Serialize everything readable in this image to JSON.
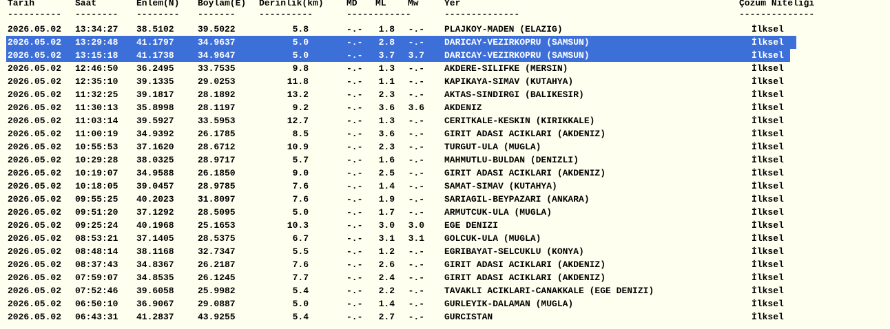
{
  "columns": {
    "date": "Tarih",
    "time": "Saat",
    "lat": "Enlem(N)",
    "lon": "Boylam(E)",
    "depth": "Derinlik(km)",
    "md": "MD",
    "ml": "ML",
    "mw": "Mw",
    "place": "Yer",
    "quality": "Çözüm Niteliği"
  },
  "separators": {
    "date": "----------",
    "time": "--------",
    "lat": "--------",
    "lon": "-------",
    "depth": "----------",
    "mag": "------------",
    "place": "--------------",
    "quality": "--------------"
  },
  "rows": [
    {
      "date": "2026.05.02",
      "time": "13:34:27",
      "lat": "38.5102",
      "lon": "39.5022",
      "depth": "5.8",
      "md": "-.-",
      "ml": "1.8",
      "mw": "-.-",
      "place": "PLAJKOY-MADEN (ELAZIG)",
      "quality": "İlksel",
      "selected": false
    },
    {
      "date": "2026.05.02",
      "time": "13:29:48",
      "lat": "41.1797",
      "lon": "34.9637",
      "depth": "5.0",
      "md": "-.-",
      "ml": "2.8",
      "mw": "-.-",
      "place": "DARICAY-VEZIRKOPRU (SAMSUN)",
      "quality": "İlksel",
      "selected": true
    },
    {
      "date": "2026.05.02",
      "time": "13:15:18",
      "lat": "41.1738",
      "lon": "34.9647",
      "depth": "5.0",
      "md": "-.-",
      "ml": "3.7",
      "mw": "3.7",
      "place": "DARICAY-VEZIRKOPRU (SAMSUN)",
      "quality": "İlksel",
      "selected": true
    },
    {
      "date": "2026.05.02",
      "time": "12:46:50",
      "lat": "36.2495",
      "lon": "33.7535",
      "depth": "9.8",
      "md": "-.-",
      "ml": "1.3",
      "mw": "-.-",
      "place": "AKDERE-SILIFKE (MERSIN)",
      "quality": "İlksel",
      "selected": false
    },
    {
      "date": "2026.05.02",
      "time": "12:35:10",
      "lat": "39.1335",
      "lon": "29.0253",
      "depth": "11.8",
      "md": "-.-",
      "ml": "1.1",
      "mw": "-.-",
      "place": "KAPIKAYA-SIMAV (KUTAHYA)",
      "quality": "İlksel",
      "selected": false
    },
    {
      "date": "2026.05.02",
      "time": "11:32:25",
      "lat": "39.1817",
      "lon": "28.1892",
      "depth": "13.2",
      "md": "-.-",
      "ml": "2.3",
      "mw": "-.-",
      "place": "AKTAS-SINDIRGI (BALIKESIR)",
      "quality": "İlksel",
      "selected": false
    },
    {
      "date": "2026.05.02",
      "time": "11:30:13",
      "lat": "35.8998",
      "lon": "28.1197",
      "depth": "9.2",
      "md": "-.-",
      "ml": "3.6",
      "mw": "3.6",
      "place": "AKDENIZ",
      "quality": "İlksel",
      "selected": false
    },
    {
      "date": "2026.05.02",
      "time": "11:03:14",
      "lat": "39.5927",
      "lon": "33.5953",
      "depth": "12.7",
      "md": "-.-",
      "ml": "1.3",
      "mw": "-.-",
      "place": "CERITKALE-KESKIN (KIRIKKALE)",
      "quality": "İlksel",
      "selected": false
    },
    {
      "date": "2026.05.02",
      "time": "11:00:19",
      "lat": "34.9392",
      "lon": "26.1785",
      "depth": "8.5",
      "md": "-.-",
      "ml": "3.6",
      "mw": "-.-",
      "place": "GIRIT ADASI ACIKLARI (AKDENIZ)",
      "quality": "İlksel",
      "selected": false
    },
    {
      "date": "2026.05.02",
      "time": "10:55:53",
      "lat": "37.1620",
      "lon": "28.6712",
      "depth": "10.9",
      "md": "-.-",
      "ml": "2.3",
      "mw": "-.-",
      "place": "TURGUT-ULA (MUGLA)",
      "quality": "İlksel",
      "selected": false
    },
    {
      "date": "2026.05.02",
      "time": "10:29:28",
      "lat": "38.0325",
      "lon": "28.9717",
      "depth": "5.7",
      "md": "-.-",
      "ml": "1.6",
      "mw": "-.-",
      "place": "MAHMUTLU-BULDAN (DENIZLI)",
      "quality": "İlksel",
      "selected": false
    },
    {
      "date": "2026.05.02",
      "time": "10:19:07",
      "lat": "34.9588",
      "lon": "26.1850",
      "depth": "9.0",
      "md": "-.-",
      "ml": "2.5",
      "mw": "-.-",
      "place": "GIRIT ADASI ACIKLARI (AKDENIZ)",
      "quality": "İlksel",
      "selected": false
    },
    {
      "date": "2026.05.02",
      "time": "10:18:05",
      "lat": "39.0457",
      "lon": "28.9785",
      "depth": "7.6",
      "md": "-.-",
      "ml": "1.4",
      "mw": "-.-",
      "place": "SAMAT-SIMAV (KUTAHYA)",
      "quality": "İlksel",
      "selected": false
    },
    {
      "date": "2026.05.02",
      "time": "09:55:25",
      "lat": "40.2023",
      "lon": "31.8097",
      "depth": "7.6",
      "md": "-.-",
      "ml": "1.9",
      "mw": "-.-",
      "place": "SARIAGIL-BEYPAZARI (ANKARA)",
      "quality": "İlksel",
      "selected": false
    },
    {
      "date": "2026.05.02",
      "time": "09:51:20",
      "lat": "37.1292",
      "lon": "28.5095",
      "depth": "5.0",
      "md": "-.-",
      "ml": "1.7",
      "mw": "-.-",
      "place": "ARMUTCUK-ULA (MUGLA)",
      "quality": "İlksel",
      "selected": false
    },
    {
      "date": "2026.05.02",
      "time": "09:25:24",
      "lat": "40.1968",
      "lon": "25.1653",
      "depth": "10.3",
      "md": "-.-",
      "ml": "3.0",
      "mw": "3.0",
      "place": "EGE DENIZI",
      "quality": "İlksel",
      "selected": false
    },
    {
      "date": "2026.05.02",
      "time": "08:53:21",
      "lat": "37.1405",
      "lon": "28.5375",
      "depth": "6.7",
      "md": "-.-",
      "ml": "3.1",
      "mw": "3.1",
      "place": "GOLCUK-ULA (MUGLA)",
      "quality": "İlksel",
      "selected": false
    },
    {
      "date": "2026.05.02",
      "time": "08:48:14",
      "lat": "38.1168",
      "lon": "32.7347",
      "depth": "5.5",
      "md": "-.-",
      "ml": "1.2",
      "mw": "-.-",
      "place": "EGRIBAYAT-SELCUKLU (KONYA)",
      "quality": "İlksel",
      "selected": false
    },
    {
      "date": "2026.05.02",
      "time": "08:37:43",
      "lat": "34.8367",
      "lon": "26.2187",
      "depth": "7.6",
      "md": "-.-",
      "ml": "2.6",
      "mw": "-.-",
      "place": "GIRIT ADASI ACIKLARI (AKDENIZ)",
      "quality": "İlksel",
      "selected": false
    },
    {
      "date": "2026.05.02",
      "time": "07:59:07",
      "lat": "34.8535",
      "lon": "26.1245",
      "depth": "7.7",
      "md": "-.-",
      "ml": "2.4",
      "mw": "-.-",
      "place": "GIRIT ADASI ACIKLARI (AKDENIZ)",
      "quality": "İlksel",
      "selected": false
    },
    {
      "date": "2026.05.02",
      "time": "07:52:46",
      "lat": "39.6058",
      "lon": "25.9982",
      "depth": "5.4",
      "md": "-.-",
      "ml": "2.2",
      "mw": "-.-",
      "place": "TAVAKLI ACIKLARI-CANAKKALE (EGE DENIZI)",
      "quality": "İlksel",
      "selected": false
    },
    {
      "date": "2026.05.02",
      "time": "06:50:10",
      "lat": "36.9067",
      "lon": "29.0887",
      "depth": "5.0",
      "md": "-.-",
      "ml": "1.4",
      "mw": "-.-",
      "place": "GURLEYIK-DALAMAN (MUGLA)",
      "quality": "İlksel",
      "selected": false
    },
    {
      "date": "2026.05.02",
      "time": "06:43:31",
      "lat": "41.2837",
      "lon": "43.9255",
      "depth": "5.4",
      "md": "-.-",
      "ml": "2.7",
      "mw": "-.-",
      "place": "GURCISTAN",
      "quality": "İlksel",
      "selected": false
    }
  ]
}
